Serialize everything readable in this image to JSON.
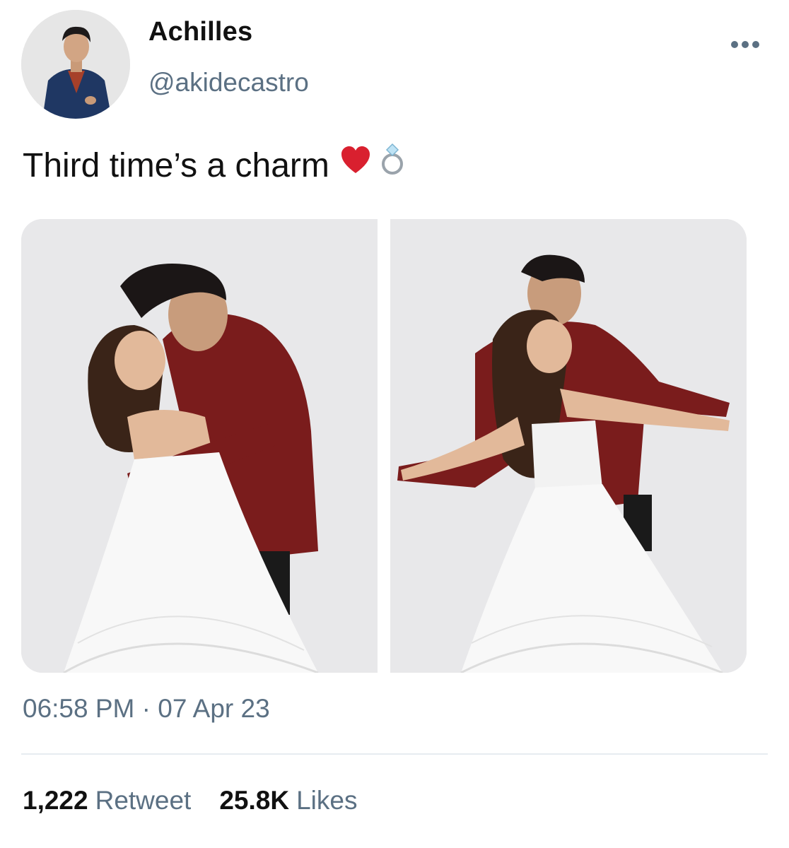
{
  "user": {
    "display_name": "Achilles",
    "handle": "@akidecastro"
  },
  "tweet": {
    "text": "Third time’s a charm",
    "emojis": [
      "heart-icon",
      "ring-icon"
    ],
    "timestamp": "06:58 PM · 07 Apr 23",
    "media_count": 2
  },
  "stats": {
    "retweet_count": "1,222",
    "retweet_label": "Retweet",
    "likes_count": "25.8K",
    "likes_label": "Likes"
  },
  "colors": {
    "text_primary": "#111111",
    "text_secondary": "#5b7083",
    "divider": "#e6ecf0",
    "heart": "#d9202f",
    "jacket": "#7a1c1c"
  },
  "icons": {
    "more": "more-horizontal-icon"
  }
}
